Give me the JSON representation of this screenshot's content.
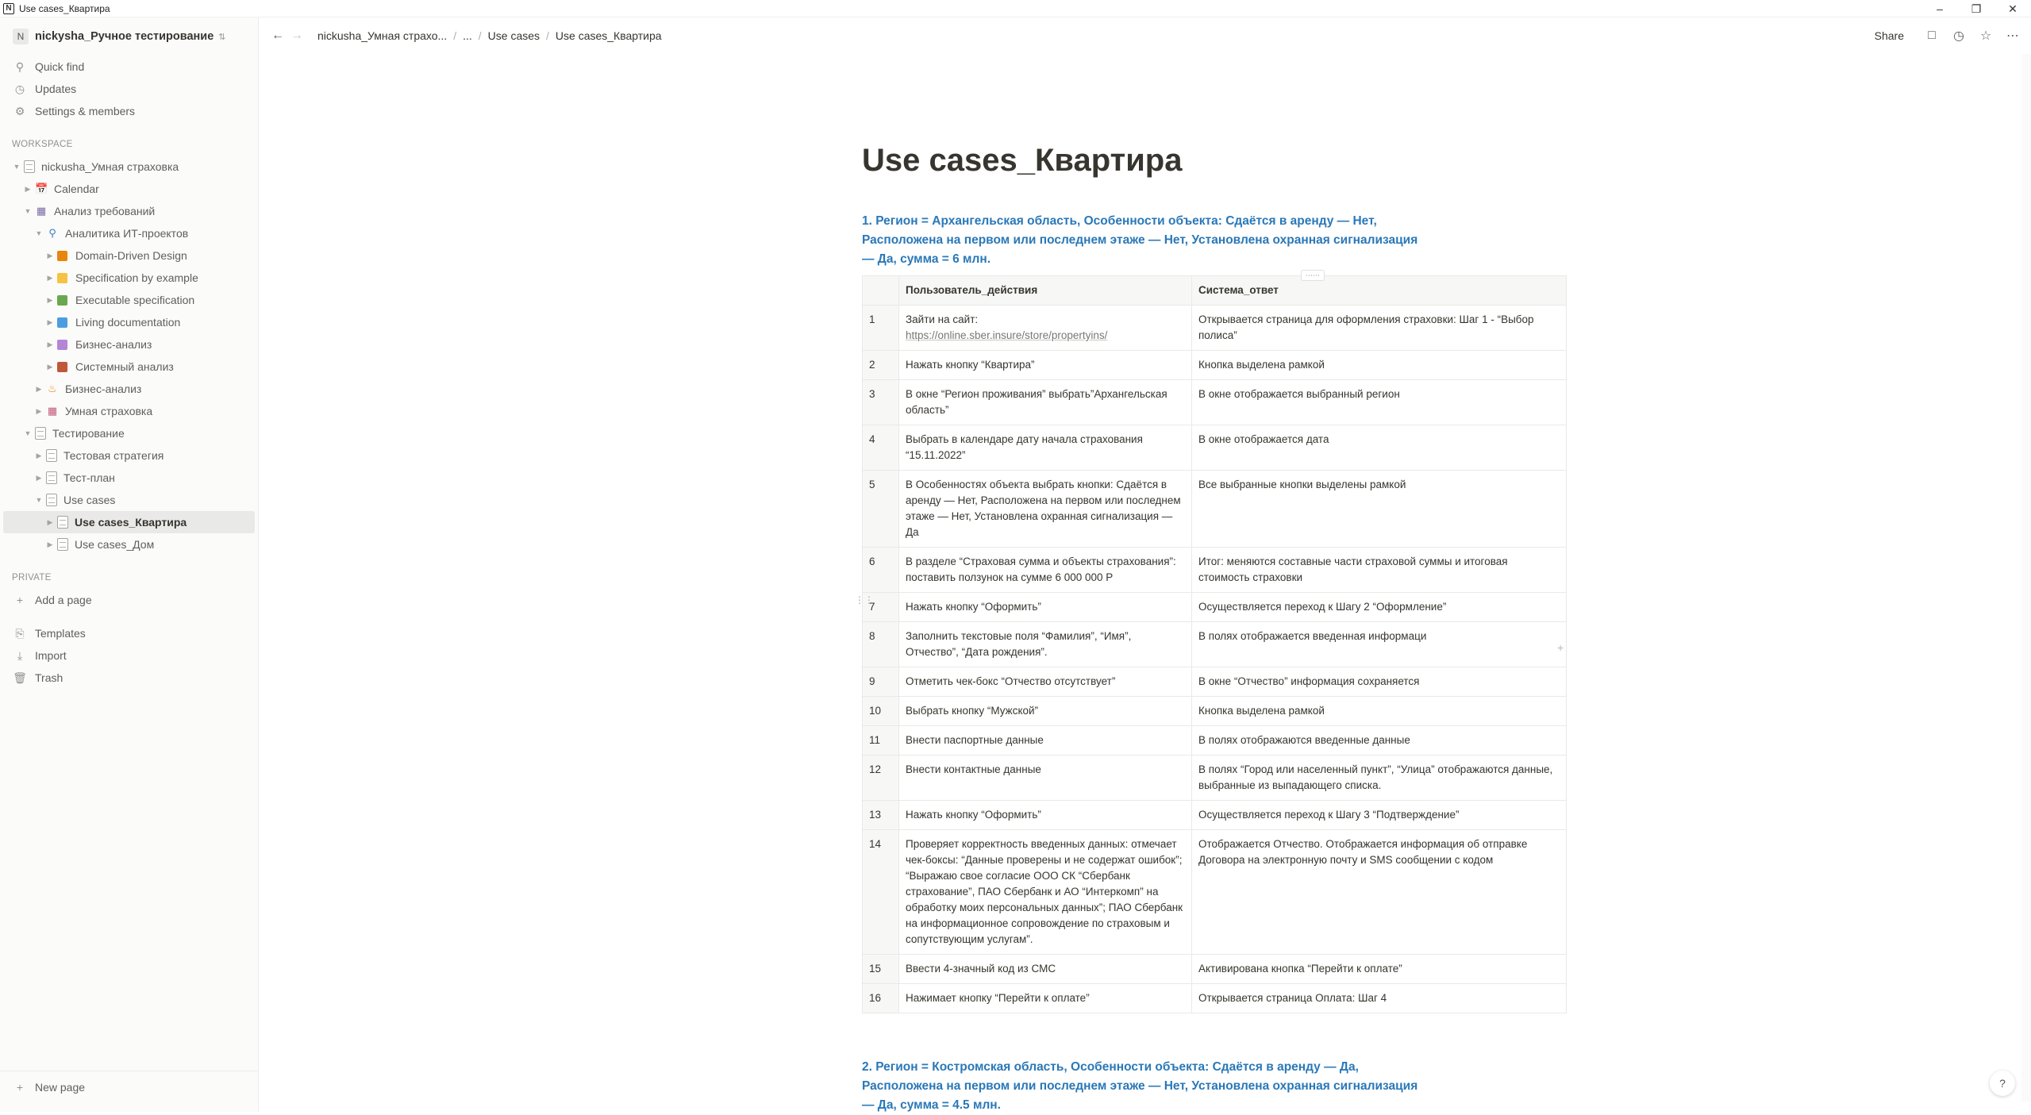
{
  "window": {
    "title": "Use cases_Квартира",
    "app_icon": "notion-icon"
  },
  "sidebar": {
    "workspace_badge": "N",
    "workspace_name": "nickysha_Ручное тестирование",
    "top_items": [
      {
        "label": "Quick find",
        "icon": "search-icon"
      },
      {
        "label": "Updates",
        "icon": "clock-icon"
      },
      {
        "label": "Settings & members",
        "icon": "gear-icon"
      }
    ],
    "workspace_section": "WORKSPACE",
    "tree": [
      {
        "label": "nickusha_Умная страховка",
        "level": 0,
        "expanded": true,
        "icon": "page"
      },
      {
        "label": "Calendar",
        "level": 1,
        "expanded": false,
        "icon": "calendar"
      },
      {
        "label": "Анализ требований",
        "level": 1,
        "expanded": true,
        "icon": "books"
      },
      {
        "label": "Аналитика ИТ-проектов",
        "level": 2,
        "expanded": true,
        "icon": "magnifier"
      },
      {
        "label": "Domain-Driven Design",
        "level": 3,
        "expanded": false,
        "icon": "square",
        "color": "#e8850c"
      },
      {
        "label": "Specification by example",
        "level": 3,
        "expanded": false,
        "icon": "square",
        "color": "#f5c242"
      },
      {
        "label": "Executable specification",
        "level": 3,
        "expanded": false,
        "icon": "square",
        "color": "#6aa84f"
      },
      {
        "label": "Living documentation",
        "level": 3,
        "expanded": false,
        "icon": "square",
        "color": "#4a9ee0"
      },
      {
        "label": "Бизнес-анализ",
        "level": 3,
        "expanded": false,
        "icon": "square",
        "color": "#b486d6"
      },
      {
        "label": "Системный анализ",
        "level": 3,
        "expanded": false,
        "icon": "square",
        "color": "#c0583a"
      },
      {
        "label": "Бизнес-анализ",
        "level": 2,
        "expanded": false,
        "icon": "fire"
      },
      {
        "label": "Умная страховка",
        "level": 2,
        "expanded": false,
        "icon": "gift"
      },
      {
        "label": "Тестирование",
        "level": 1,
        "expanded": true,
        "icon": "page"
      },
      {
        "label": "Тестовая стратегия",
        "level": 2,
        "expanded": false,
        "icon": "page"
      },
      {
        "label": "Тест-план",
        "level": 2,
        "expanded": false,
        "icon": "page"
      },
      {
        "label": "Use cases",
        "level": 2,
        "expanded": true,
        "icon": "page"
      },
      {
        "label": "Use cases_Квартира",
        "level": 3,
        "expanded": false,
        "icon": "page",
        "selected": true
      },
      {
        "label": "Use cases_Дом",
        "level": 3,
        "expanded": false,
        "icon": "page"
      }
    ],
    "private_section": "PRIVATE",
    "add_page": "Add a page",
    "bottom_items": [
      {
        "label": "Templates",
        "icon": "templates-icon"
      },
      {
        "label": "Import",
        "icon": "import-icon"
      },
      {
        "label": "Trash",
        "icon": "trash-icon"
      }
    ],
    "new_page": "New page"
  },
  "topbar": {
    "breadcrumbs": [
      "nickusha_Умная страхо...",
      "...",
      "Use cases",
      "Use cases_Квартира"
    ],
    "share": "Share"
  },
  "page": {
    "title": "Use cases_Квартира",
    "case1_heading": "1. Регион = Архангельская область, Особенности объекта: Сдаётся в аренду — Нет, Расположена на первом или последнем этаже — Нет, Установлена охранная сигнализация — Да, сумма = 6 млн.",
    "table_headers": {
      "user": "Пользователь_действия",
      "system": "Система_ответ"
    },
    "rows": [
      {
        "n": "1",
        "user": "Зайти на сайт:",
        "user_link": "https://online.sber.insure/store/propertyins/",
        "system": "Открывается страница для оформления страховки: Шаг 1 - “Выбор полиса”"
      },
      {
        "n": "2",
        "user": "Нажать кнопку “Квартира”",
        "system": "Кнопка выделена рамкой"
      },
      {
        "n": "3",
        "user": "В окне “Регион проживания” выбрать”Архангельская область”",
        "system": "В окне отображается выбранный регион"
      },
      {
        "n": "4",
        "user": "Выбрать в календаре дату начала страхования “15.11.2022”",
        "system": "В окне отображается дата"
      },
      {
        "n": "5",
        "user": "В Особенностях объекта выбрать кнопки: Сдаётся в аренду — Нет, Расположена на первом или последнем этаже — Нет, Установлена охранная сигнализация — Да",
        "system": "Все выбранные кнопки выделены рамкой"
      },
      {
        "n": "6",
        "user": "В разделе “Страховая сумма и объекты страхования”: поставить ползунок на сумме 6 000 000 Р",
        "system": "Итог: меняются составные части страховой суммы и итоговая стоимость страховки"
      },
      {
        "n": "7",
        "user": "Нажать кнопку “Оформить”",
        "system": "Осуществляется переход  к Шагу 2 “Оформление”"
      },
      {
        "n": "8",
        "user": "Заполнить текстовые поля “Фамилия”, “Имя”, Отчество”, “Дата рождения”.",
        "system": "В полях отображается введенная информаци"
      },
      {
        "n": "9",
        "user": "Отметить чек-бокс “Отчество отсутствует”",
        "system": "В окне “Отчество” информация сохраняется"
      },
      {
        "n": "10",
        "user": "Выбрать кнопку “Мужской”",
        "system": "Кнопка выделена рамкой"
      },
      {
        "n": "11",
        "user": "Внести паспортные данные",
        "system": "В полях отображаются введенные данные"
      },
      {
        "n": "12",
        "user": "Внести контактные данные",
        "system": "В полях “Город или населенный пункт”, “Улица” отображаются данные, выбранные из выпадающего списка."
      },
      {
        "n": "13",
        "user": "Нажать кнопку “Оформить”",
        "system": "Осуществляется переход к Шагу 3 “Подтверждение”"
      },
      {
        "n": "14",
        "user": "Проверяет корректность введенных данных: отмечает чек-боксы: “Данные проверены и не содержат ошибок”; “Выражаю свое согласие ООО СК “Сбербанк страхование”, ПАО Сбербанк и АО “Интеркомп” на обработку моих персональных данных”; ПАО Сбербанк на информационное сопровождение по страховым и сопутствующим услугам”.",
        "system": "Отображается Отчество. Отображается информация об отправке Договора на электронную почту и SMS сообщении с кодом"
      },
      {
        "n": "15",
        "user": "Ввести 4-значный код из СМС",
        "system": "Активирована кнопка “Перейти к оплате”"
      },
      {
        "n": "16",
        "user": "Нажимает кнопку “Перейти к оплате”",
        "system": "Открывается страница Оплата: Шаг 4"
      }
    ],
    "case2_heading": "2. Регион = Костромская область, Особенности объекта: Сдаётся в аренду — Да, Расположена на первом или последнем этаже — Нет, Установлена охранная сигнализация — Да, сумма = 4.5 млн."
  },
  "help": "?"
}
